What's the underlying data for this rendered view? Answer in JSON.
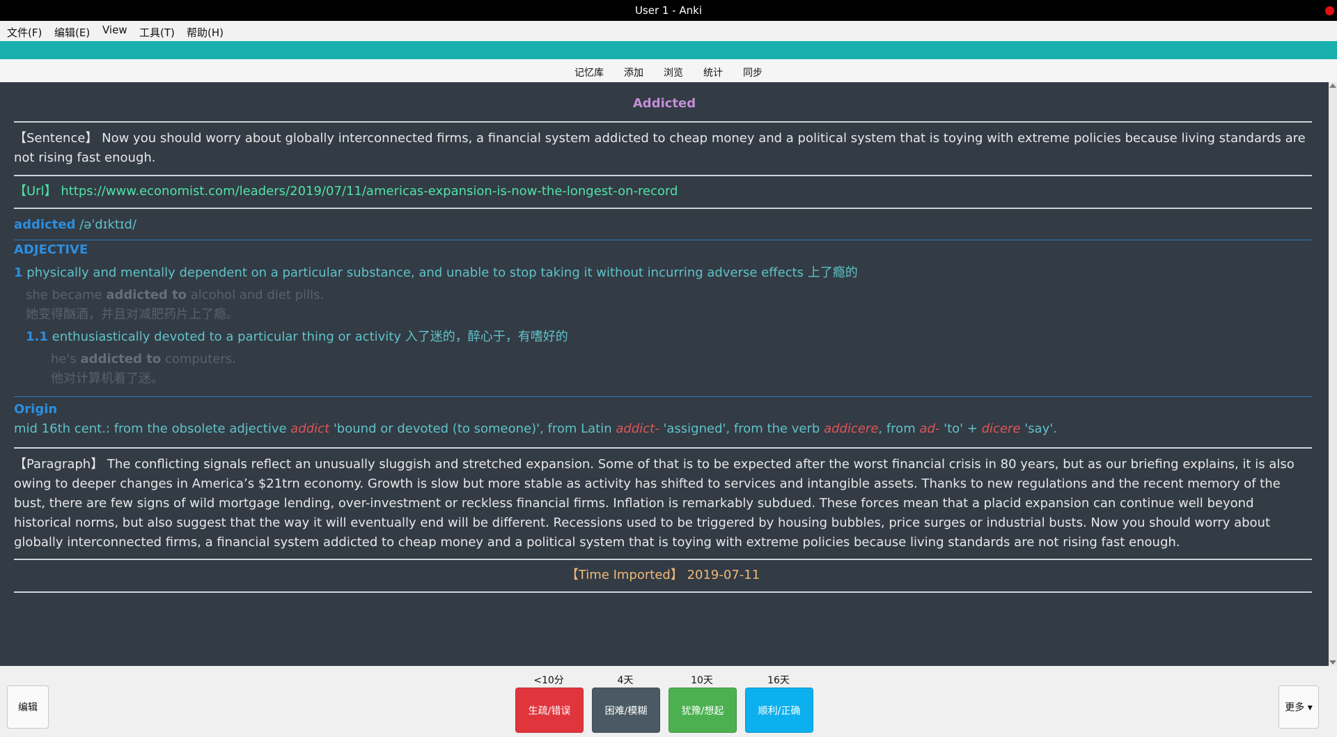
{
  "window": {
    "title": "User 1 - Anki"
  },
  "menu": [
    "文件(F)",
    "编辑(E)",
    "View",
    "工具(T)",
    "帮助(H)"
  ],
  "toolbar": [
    "记忆库",
    "添加",
    "浏览",
    "统计",
    "同步"
  ],
  "card": {
    "title": "Addicted",
    "sentence": "【Sentence】 Now you should worry about globally interconnected firms, a financial system addicted to cheap money and a political system that is toying with extreme policies because living standards are not rising fast enough.",
    "url_label": "【Url】",
    "url": "https://www.economist.com/leaders/2019/07/11/americas-expansion-is-now-the-longest-on-record",
    "headword": "addicted",
    "pron": "/əˈdɪktɪd/",
    "pos": "ADJECTIVE",
    "sense1_num": "1",
    "sense1_text": "physically and mentally dependent on a particular substance, and unable to stop taking it without incurring adverse effects 上了瘾的",
    "ex1_pre": "she became ",
    "ex1_bold": "addicted to",
    "ex1_post": " alcohol and diet pills.",
    "ex1_cn": "她变得酗酒，并且对减肥药片上了瘾。",
    "sense11_num": "1.1",
    "sense11_text": "enthusiastically devoted to a particular thing or activity 入了迷的，醉心于，有嗜好的",
    "ex2_pre": "he's ",
    "ex2_bold": "addicted to",
    "ex2_post": " computers.",
    "ex2_cn": "他对计算机着了迷。",
    "origin_title": "Origin",
    "origin": {
      "t1": "mid 16th cent.: from the obsolete adjective ",
      "w1": "addict",
      "t2": " 'bound or devoted (to someone)', from Latin ",
      "w2": "addict-",
      "t3": " 'assigned', from the verb ",
      "w3": "addicere",
      "t4": ", from ",
      "w4": "ad-",
      "t5": " 'to' + ",
      "w5": "dicere",
      "t6": " 'say'."
    },
    "paragraph": "【Paragraph】 The conflicting signals reflect an unusually sluggish and stretched expansion. Some of that is to be expected after the worst financial crisis in 80 years, but as our briefing explains, it is also owing to deeper changes in America’s $21trn economy. Growth is slow but more stable as activity has shifted to services and intangible assets. Thanks to new regulations and the recent memory of the bust, there are few signs of wild mortgage lending, over-investment or reckless financial firms. Inflation is remarkably subdued. These forces mean that a placid expansion can continue well beyond historical norms, but also suggest that the way it will eventually end will be different. Recessions used to be triggered by housing bubbles, price surges or industrial busts. Now you should worry about globally interconnected firms, a financial system addicted to cheap money and a political system that is toying with extreme policies because living standards are not rising fast enough.",
    "time_label": "【Time Imported】",
    "time_value": "2019-07-11"
  },
  "bottom": {
    "edit": "编辑",
    "more": "更多 ▾",
    "answers": [
      {
        "interval": "<10分",
        "label": "生疏/错误",
        "color": "#e0353d"
      },
      {
        "interval": "4天",
        "label": "困难/模糊",
        "color": "#4a5963"
      },
      {
        "interval": "10天",
        "label": "犹豫/想起",
        "color": "#4cb050"
      },
      {
        "interval": "16天",
        "label": "顺利/正确",
        "color": "#0db0ee"
      }
    ]
  }
}
